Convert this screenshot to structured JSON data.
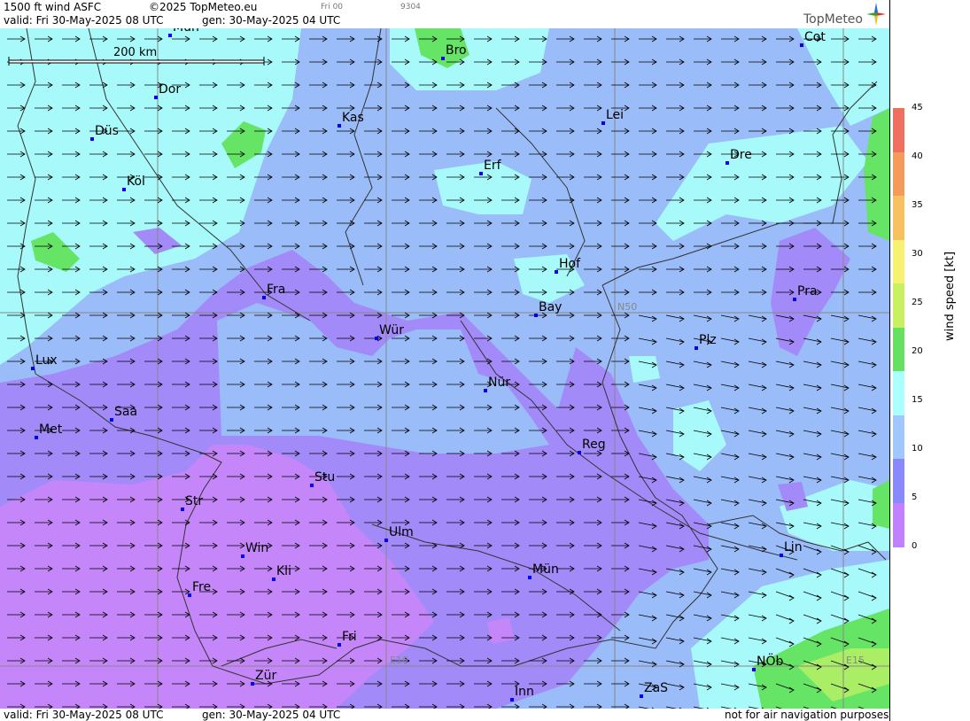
{
  "header": {
    "product": "1500 ft wind ASFC",
    "copyright": "©2025 TopMeteo.eu",
    "run_small": "Fri 00",
    "code_small": "9304",
    "valid_line": "valid:  Fri  30-May-2025  08 UTC",
    "gen_line": "gen: 30-May-2025 04 UTC",
    "logo": "TopMeteo"
  },
  "footer": {
    "valid_line": "valid:  Fri  30-May-2025  08 UTC",
    "gen_line": "gen: 30-May-2025 04 UTC",
    "disclaimer": "not for air navigation purposes"
  },
  "scale": {
    "label": "200 km"
  },
  "grid_labels": {
    "n50": "N50",
    "e10": "E10",
    "e15": "E15"
  },
  "cities": [
    {
      "name": "Mün",
      "id": "muenster"
    },
    {
      "name": "Bro"
    },
    {
      "name": "Cot"
    },
    {
      "name": "Dor"
    },
    {
      "name": "Kas"
    },
    {
      "name": "Lei"
    },
    {
      "name": "Düs"
    },
    {
      "name": "Erf"
    },
    {
      "name": "Dre"
    },
    {
      "name": "Köl"
    },
    {
      "name": "Hof"
    },
    {
      "name": "Fra"
    },
    {
      "name": "Pra"
    },
    {
      "name": "Bay"
    },
    {
      "name": "Wür"
    },
    {
      "name": "Plz"
    },
    {
      "name": "Lux"
    },
    {
      "name": "Nür"
    },
    {
      "name": "Saa"
    },
    {
      "name": "Met"
    },
    {
      "name": "Reg"
    },
    {
      "name": "Stu"
    },
    {
      "name": "Str"
    },
    {
      "name": "Ulm"
    },
    {
      "name": "Win"
    },
    {
      "name": "Lin"
    },
    {
      "name": "Kli"
    },
    {
      "name": "Mün"
    },
    {
      "name": "Fre"
    },
    {
      "name": "Fri"
    },
    {
      "name": "NÖb"
    },
    {
      "name": "Zür"
    },
    {
      "name": "ZaS"
    },
    {
      "name": "Inn"
    }
  ],
  "legend": {
    "unit": "wind speed [kt]",
    "ticks": [
      "45",
      "40",
      "35",
      "30",
      "25",
      "20",
      "15",
      "10",
      "5",
      "0"
    ],
    "colors": [
      "#f07060",
      "#f49a5a",
      "#f8c060",
      "#f8f070",
      "#c8f060",
      "#66e060",
      "#aaffff",
      "#a0c8ff",
      "#8888ff",
      "#c080ff"
    ]
  },
  "colors": {
    "calm": "#c486f8",
    "v5": "#a28af8",
    "v10": "#9abcf8",
    "v15": "#a8fafa",
    "v20": "#66e466",
    "v25": "#aaee66"
  }
}
